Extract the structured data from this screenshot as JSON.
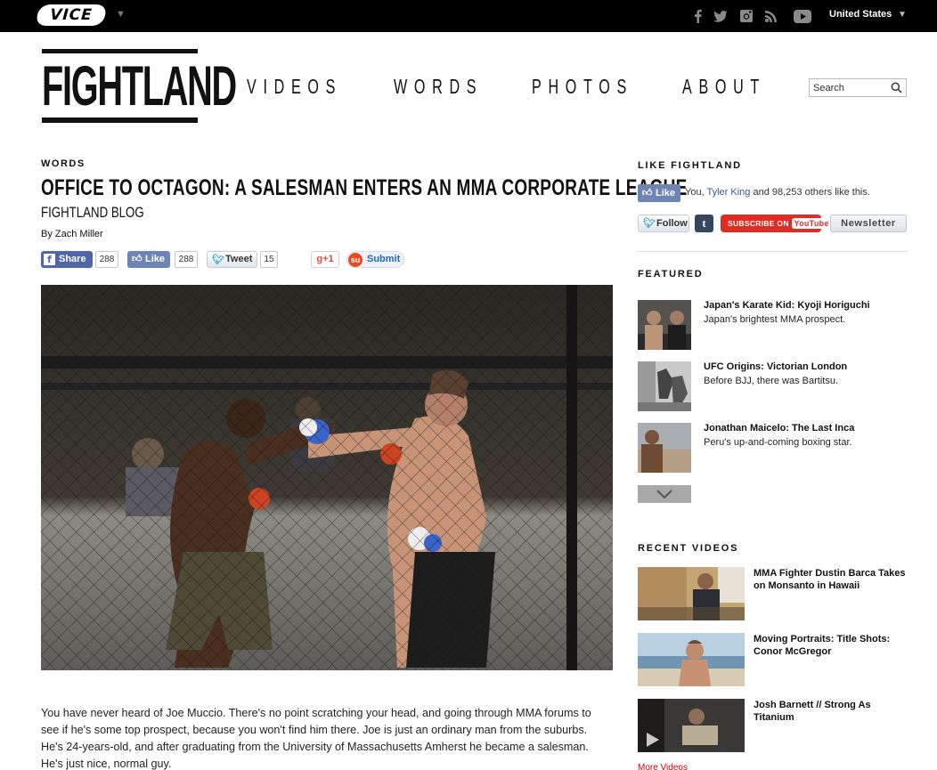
{
  "topbar": {
    "brand": "VICE",
    "country": "United States",
    "social_icons": [
      "facebook-icon",
      "twitter-icon",
      "instagram-icon",
      "rss-icon",
      "youtube-icon"
    ]
  },
  "header": {
    "logo": "FIGHTLAND",
    "nav": [
      "VIDEOS",
      "WORDS",
      "PHOTOS",
      "ABOUT"
    ],
    "search_placeholder": "Search"
  },
  "article": {
    "section": "WORDS",
    "title": "OFFICE TO OCTAGON: A SALESMAN ENTERS AN MMA CORPORATE LEAGUE",
    "blog": "FIGHTLAND BLOG",
    "byline": "By Zach Miller",
    "share": {
      "fb_share_label": "Share",
      "fb_share_count": "288",
      "fb_like_label": "Like",
      "fb_like_count": "288",
      "tweet_label": "Tweet",
      "tweet_count": "15",
      "gplus_label": "g+1",
      "submit_label": "Submit"
    },
    "body": "You have never heard of Joe Muccio. There's no point scratching your head, and going through MMA forums to see if he's some top prospect, because you won't find him there. Joe is just an ordinary man from the suburbs. He's 24-years-old, and after graduating from the University of Massachusetts Amherst he became a salesman. He's just nice, normal guy."
  },
  "sidebar": {
    "like_heading": "LIKE FIGHTLAND",
    "like_button": "Like",
    "like_text_pre": "You, ",
    "like_text_link": "Tyler King",
    "like_text_post": " and 98,253 others like this.",
    "follow_label": "Follow",
    "tumblr_label": "t",
    "subscribe_label": "SUBSCRIBE ON",
    "youtube_label": "YouTube",
    "newsletter_label": "Newsletter",
    "featured_heading": "FEATURED",
    "featured": [
      {
        "title": "Japan's Karate Kid: Kyoji Horiguchi",
        "desc": "Japan's brightest MMA prospect."
      },
      {
        "title": "UFC Origins: Victorian London",
        "desc": "Before BJJ, there was Bartitsu."
      },
      {
        "title": "Jonathan Maicelo: The Last Inca",
        "desc": "Peru's up-and-coming boxing star."
      }
    ],
    "recent_heading": "RECENT VIDEOS",
    "recent": [
      {
        "title": "MMA Fighter Dustin Barca Takes on Monsanto in Hawaii"
      },
      {
        "title": "Moving Portraits: Title Shots: Conor McGregor"
      },
      {
        "title": "Josh Barnett // Strong As Titanium"
      }
    ],
    "more_videos": "More Videos"
  },
  "colors": {
    "topbar": "#000000",
    "facebook": "#4f67a4",
    "like": "#6d84b4",
    "youtube": "#e12b25",
    "tumblr": "#36465d",
    "stumble": "#eb4924"
  }
}
